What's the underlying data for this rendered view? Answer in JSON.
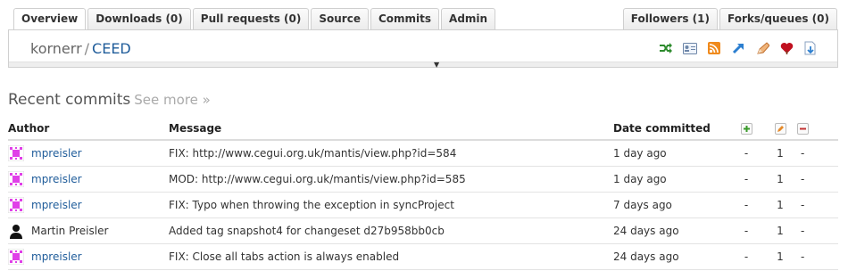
{
  "tabs_left": [
    {
      "label": "Overview",
      "active": true
    },
    {
      "label": "Downloads (0)",
      "active": false
    },
    {
      "label": "Pull requests (0)",
      "active": false
    },
    {
      "label": "Source",
      "active": false
    },
    {
      "label": "Commits",
      "active": false
    },
    {
      "label": "Admin",
      "active": false
    }
  ],
  "tabs_right": [
    {
      "label": "Followers (1)"
    },
    {
      "label": "Forks/queues (0)"
    }
  ],
  "repo": {
    "owner": "kornerr",
    "separator": "/",
    "name": "CEED"
  },
  "repo_icons": [
    "shuffle-icon",
    "id-card-icon",
    "rss-icon",
    "fork-arrow-icon",
    "edit-pencil-icon",
    "heart-icon",
    "download-icon"
  ],
  "recent": {
    "title": "Recent commits",
    "see_more": "See more »"
  },
  "table": {
    "headers": {
      "author": "Author",
      "message": "Message",
      "date": "Date committed"
    },
    "rows": [
      {
        "author": "mpreisler",
        "avatar": "pixel",
        "message": "FIX: http://www.cegui.org.uk/mantis/view.php?id=584",
        "date": "1 day ago",
        "added": "-",
        "modified": "1",
        "removed": "-"
      },
      {
        "author": "mpreisler",
        "avatar": "pixel",
        "message": "MOD: http://www.cegui.org.uk/mantis/view.php?id=585",
        "date": "1 day ago",
        "added": "-",
        "modified": "1",
        "removed": "-"
      },
      {
        "author": "mpreisler",
        "avatar": "pixel",
        "message": "FIX: Typo when throwing the exception in syncProject",
        "date": "7 days ago",
        "added": "-",
        "modified": "1",
        "removed": "-"
      },
      {
        "author": "Martin Preisler",
        "avatar": "silhouette",
        "message": "Added tag snapshot4 for changeset d27b958bb0cb",
        "date": "24 days ago",
        "added": "-",
        "modified": "1",
        "removed": "-"
      },
      {
        "author": "mpreisler",
        "avatar": "pixel",
        "message": "FIX: Close all tabs action is always enabled",
        "date": "24 days ago",
        "added": "-",
        "modified": "1",
        "removed": "-"
      }
    ]
  },
  "colors": {
    "link": "#1f5c9a",
    "added": "#3a9a2a",
    "modified": "#d27400",
    "removed": "#c33333",
    "pixel_avatar": "#e040e8"
  }
}
